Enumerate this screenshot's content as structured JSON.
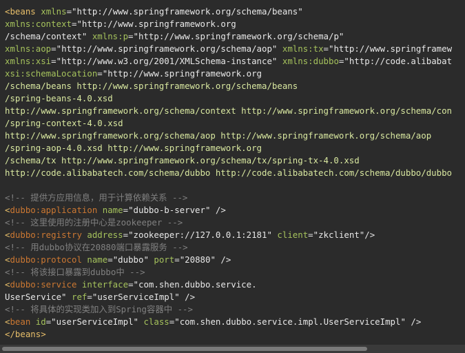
{
  "code": {
    "lines": [
      [
        {
          "t": "<",
          "c": "tag"
        },
        {
          "t": "beans",
          "c": "tag"
        },
        {
          "t": " ",
          "c": "text"
        },
        {
          "t": "xmlns",
          "c": "attrgreen"
        },
        {
          "t": "=",
          "c": "text"
        },
        {
          "t": "\"http://www.springframework.org/schema/beans\"",
          "c": "str"
        }
      ],
      [
        {
          "t": "xmlns:context",
          "c": "attrgreen"
        },
        {
          "t": "=",
          "c": "text"
        },
        {
          "t": "\"http://www.springframework.org",
          "c": "str"
        }
      ],
      [
        {
          "t": "/schema/context\"",
          "c": "str"
        },
        {
          "t": " ",
          "c": "text"
        },
        {
          "t": "xmlns:p",
          "c": "attrgreen"
        },
        {
          "t": "=",
          "c": "text"
        },
        {
          "t": "\"http://www.springframework.org/schema/p\"",
          "c": "str"
        }
      ],
      [
        {
          "t": "xmlns:aop",
          "c": "attrgreen"
        },
        {
          "t": "=",
          "c": "text"
        },
        {
          "t": "\"http://www.springframework.org/schema/aop\"",
          "c": "str"
        },
        {
          "t": " ",
          "c": "text"
        },
        {
          "t": "xmlns:tx",
          "c": "attrgreen"
        },
        {
          "t": "=",
          "c": "text"
        },
        {
          "t": "\"http://www.springframew",
          "c": "str"
        }
      ],
      [
        {
          "t": "xmlns:xsi",
          "c": "attrgreen"
        },
        {
          "t": "=",
          "c": "text"
        },
        {
          "t": "\"http://www.w3.org/2001/XMLSchema-instance\"",
          "c": "str"
        },
        {
          "t": " ",
          "c": "text"
        },
        {
          "t": "xmlns:dubbo",
          "c": "attrgreen"
        },
        {
          "t": "=",
          "c": "text"
        },
        {
          "t": "\"http://code.alibabat",
          "c": "str"
        }
      ],
      [
        {
          "t": "xsi:schemaLocation",
          "c": "attrgreen"
        },
        {
          "t": "=",
          "c": "text"
        },
        {
          "t": "\"http://www.springframework.org",
          "c": "str"
        }
      ],
      [
        {
          "t": "/schema/beans http://www.springframework.org/schema/beans",
          "c": "strg"
        }
      ],
      [
        {
          "t": "/spring-beans-4.0.xsd",
          "c": "strg"
        }
      ],
      [
        {
          "t": "http://www.springframework.org/schema/context http://www.springframework.org/schema/con",
          "c": "strg"
        }
      ],
      [
        {
          "t": "/spring-context-4.0.xsd",
          "c": "strg"
        }
      ],
      [
        {
          "t": "http://www.springframework.org/schema/aop http://www.springframework.org/schema/aop",
          "c": "strg"
        }
      ],
      [
        {
          "t": "/spring-aop-4.0.xsd http://www.springframework.org",
          "c": "strg"
        }
      ],
      [
        {
          "t": "/schema/tx http://www.springframework.org/schema/tx/spring-tx-4.0.xsd",
          "c": "strg"
        }
      ],
      [
        {
          "t": "http://code.alibabatech.com/schema/dubbo http://code.alibabatech.com/schema/dubbo/dubbo",
          "c": "strg"
        }
      ],
      [],
      [
        {
          "t": "<!-- 提供方应用信息，用于计算依赖关系 -->",
          "c": "comment"
        }
      ],
      [
        {
          "t": "<",
          "c": "tag"
        },
        {
          "t": "dubbo:application",
          "c": "ns"
        },
        {
          "t": " ",
          "c": "text"
        },
        {
          "t": "name",
          "c": "attrgreen"
        },
        {
          "t": "=",
          "c": "text"
        },
        {
          "t": "\"dubbo-b-server\"",
          "c": "str"
        },
        {
          "t": " />",
          "c": "text"
        }
      ],
      [
        {
          "t": "<!-- 这里使用的注册中心是zookeeper -->",
          "c": "comment"
        }
      ],
      [
        {
          "t": "<",
          "c": "tag"
        },
        {
          "t": "dubbo:registry",
          "c": "ns"
        },
        {
          "t": " ",
          "c": "text"
        },
        {
          "t": "address",
          "c": "attrgreen"
        },
        {
          "t": "=",
          "c": "text"
        },
        {
          "t": "\"zookeeper://127.0.0.1:2181\"",
          "c": "str"
        },
        {
          "t": " ",
          "c": "text"
        },
        {
          "t": "client",
          "c": "attrgreen"
        },
        {
          "t": "=",
          "c": "text"
        },
        {
          "t": "\"zkclient\"",
          "c": "str"
        },
        {
          "t": "/>",
          "c": "text"
        }
      ],
      [
        {
          "t": "<!-- 用dubbo协议在20880端口暴露服务 -->",
          "c": "comment"
        }
      ],
      [
        {
          "t": "<",
          "c": "tag"
        },
        {
          "t": "dubbo:protocol",
          "c": "ns"
        },
        {
          "t": " ",
          "c": "text"
        },
        {
          "t": "name",
          "c": "attrgreen"
        },
        {
          "t": "=",
          "c": "text"
        },
        {
          "t": "\"dubbo\"",
          "c": "str"
        },
        {
          "t": " ",
          "c": "text"
        },
        {
          "t": "port",
          "c": "attrgreen"
        },
        {
          "t": "=",
          "c": "text"
        },
        {
          "t": "\"20880\"",
          "c": "str"
        },
        {
          "t": " />",
          "c": "text"
        }
      ],
      [
        {
          "t": "<!-- 将该接口暴露到dubbo中 -->",
          "c": "comment"
        }
      ],
      [
        {
          "t": "<",
          "c": "tag"
        },
        {
          "t": "dubbo:service",
          "c": "ns"
        },
        {
          "t": " ",
          "c": "text"
        },
        {
          "t": "interface",
          "c": "attrgreen"
        },
        {
          "t": "=",
          "c": "text"
        },
        {
          "t": "\"com.shen.dubbo.service.",
          "c": "str"
        }
      ],
      [
        {
          "t": "UserService\"",
          "c": "str"
        },
        {
          "t": " ",
          "c": "text"
        },
        {
          "t": "ref",
          "c": "attrgreen"
        },
        {
          "t": "=",
          "c": "text"
        },
        {
          "t": "\"userServiceImpl\"",
          "c": "str"
        },
        {
          "t": " />",
          "c": "text"
        }
      ],
      [
        {
          "t": "<!-- 将具体的实现类加入到Spring容器中 -->",
          "c": "comment"
        }
      ],
      [
        {
          "t": "<",
          "c": "tag"
        },
        {
          "t": "bean",
          "c": "ns"
        },
        {
          "t": " ",
          "c": "text"
        },
        {
          "t": "id",
          "c": "attrgreen"
        },
        {
          "t": "=",
          "c": "text"
        },
        {
          "t": "\"userServiceImpl\"",
          "c": "str"
        },
        {
          "t": " ",
          "c": "text"
        },
        {
          "t": "class",
          "c": "attrgreen"
        },
        {
          "t": "=",
          "c": "text"
        },
        {
          "t": "\"com.shen.dubbo.service.impl.UserServiceImpl\"",
          "c": "str"
        },
        {
          "t": " />",
          "c": "text"
        }
      ],
      [
        {
          "t": "</",
          "c": "tag"
        },
        {
          "t": "beans",
          "c": "tag"
        },
        {
          "t": ">",
          "c": "tag"
        }
      ]
    ]
  }
}
